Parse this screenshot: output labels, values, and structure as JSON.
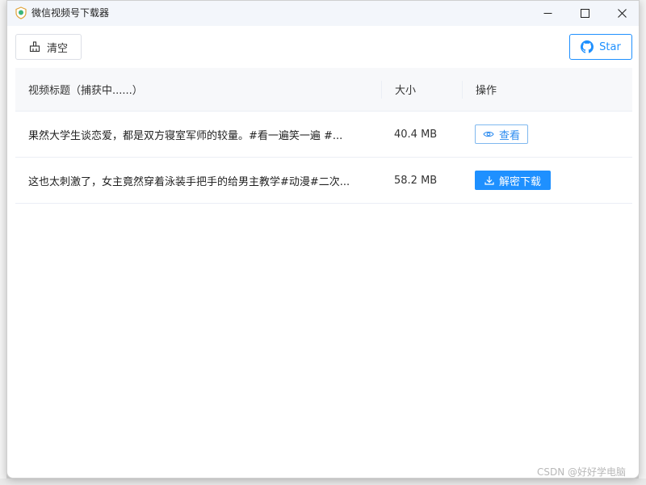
{
  "window": {
    "title": "微信视频号下载器"
  },
  "toolbar": {
    "clear_label": "清空",
    "star_label": "Star"
  },
  "table": {
    "headers": {
      "title": "视频标题（捕获中......）",
      "size": "大小",
      "action": "操作"
    },
    "rows": [
      {
        "title": "果然大学生谈恋爱，都是双方寝室军师的较量。#看一遍笑一遍 #...",
        "size": "40.4 MB",
        "action_label": "查看"
      },
      {
        "title": "这也太刺激了，女主竟然穿着泳装手把手的给男主教学#动漫#二次...",
        "size": "58.2 MB",
        "action_label": "解密下载"
      }
    ]
  },
  "watermark": "CSDN @好好学电脑",
  "colors": {
    "accent": "#1e90ff",
    "header_bg": "#f7f8fa",
    "titlebar_bg": "#f3f6fb"
  },
  "icons": {
    "clear": "broom-icon",
    "star": "github-icon",
    "view": "eye-icon",
    "download": "download-icon"
  }
}
